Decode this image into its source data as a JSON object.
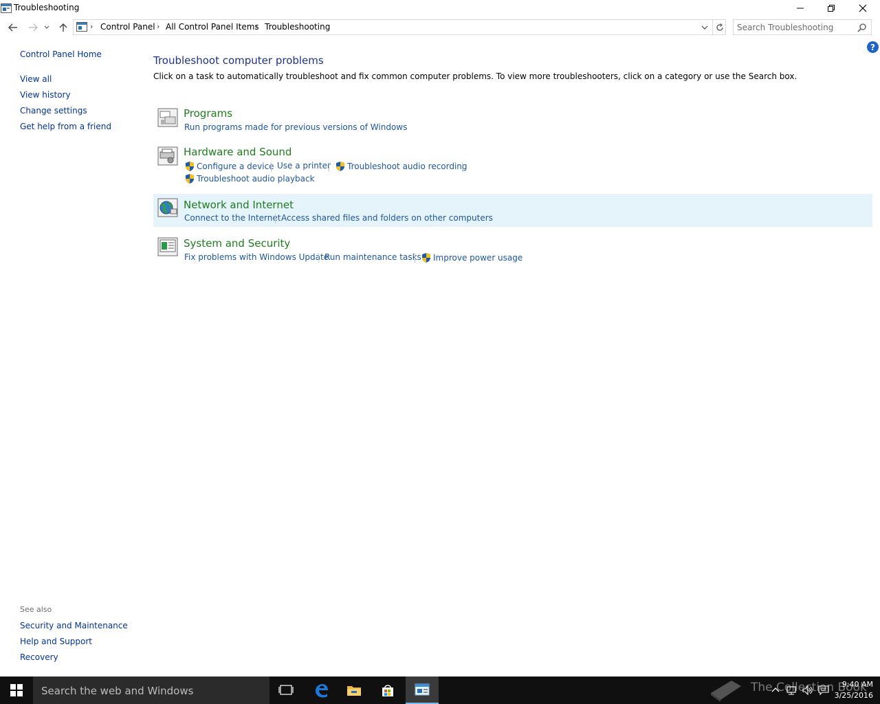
{
  "window": {
    "title": "Troubleshooting"
  },
  "breadcrumb": [
    "Control Panel",
    "All Control Panel Items",
    "Troubleshooting"
  ],
  "search": {
    "placeholder": "Search Troubleshooting"
  },
  "left_pane": {
    "home": "Control Panel Home",
    "links": [
      "View all",
      "View history",
      "Change settings",
      "Get help from a friend"
    ]
  },
  "see_also": {
    "label": "See also",
    "links": [
      "Security and Maintenance",
      "Help and Support",
      "Recovery"
    ]
  },
  "main": {
    "title": "Troubleshoot computer problems",
    "description": "Click on a task to automatically troubleshoot and fix common computer problems. To view more troubleshooters, click on a category or use the Search box.",
    "categories": [
      {
        "title": "Programs",
        "links": [
          "Run programs made for previous versions of Windows"
        ]
      },
      {
        "title": "Hardware and Sound",
        "links": [
          "Configure a device",
          "Use a printer",
          "Troubleshoot audio recording",
          "Troubleshoot audio playback"
        ]
      },
      {
        "title": "Network and Internet",
        "links": [
          "Connect to the Internet",
          "Access shared files and folders on other computers"
        ]
      },
      {
        "title": "System and Security",
        "links": [
          "Fix problems with Windows Update",
          "Run maintenance tasks",
          "Improve power usage"
        ]
      }
    ]
  },
  "taskbar": {
    "search_text": "Search the web and Windows",
    "time": "9:40 AM",
    "date": "3/25/2016",
    "watermark": "The Collection Book"
  },
  "colors": {
    "link": "#1e56a0",
    "category_title": "#1e7d1e",
    "page_title": "#1e3287",
    "hover_row": "#e5f3fb",
    "taskbar": "#101010"
  },
  "icons": [
    "back-icon",
    "forward-icon",
    "recent-icon",
    "up-icon",
    "refresh-icon",
    "search-icon",
    "help-icon",
    "shield-icon",
    "windows-logo-icon",
    "task-view-icon",
    "edge-icon",
    "file-explorer-icon",
    "store-icon",
    "control-panel-icon"
  ]
}
